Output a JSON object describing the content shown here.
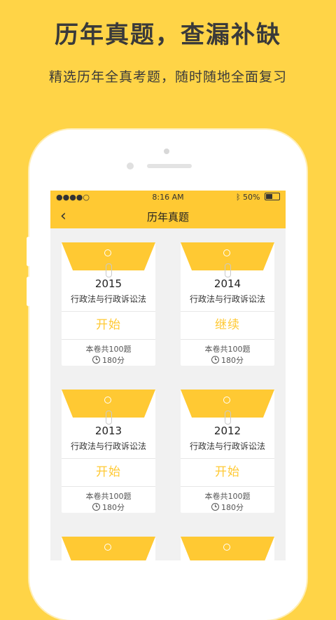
{
  "promo": {
    "headline": "历年真题，查漏补缺",
    "subline": "精选历年全真考题，随时随地全面复习"
  },
  "status": {
    "signal": "●●●●○",
    "time": "8:16 AM",
    "battery": "50%"
  },
  "nav": {
    "title": "历年真题",
    "back_icon": "chevron-left-icon"
  },
  "cards": [
    {
      "year": "2015",
      "subject": "行政法与行政诉讼法",
      "action": "开始",
      "count": "本卷共100题",
      "time": "180分"
    },
    {
      "year": "2014",
      "subject": "行政法与行政诉讼法",
      "action": "继续",
      "count": "本卷共100题",
      "time": "180分"
    },
    {
      "year": "2013",
      "subject": "行政法与行政诉讼法",
      "action": "开始",
      "count": "本卷共100题",
      "time": "180分"
    },
    {
      "year": "2012",
      "subject": "行政法与行政诉讼法",
      "action": "开始",
      "count": "本卷共100题",
      "time": "180分"
    }
  ],
  "colors": {
    "background": "#FFD447",
    "accent": "#FFC933"
  }
}
